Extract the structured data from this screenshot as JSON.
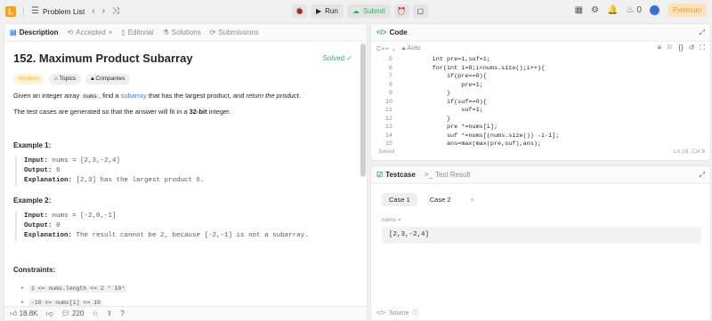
{
  "topbar": {
    "problem_list": "Problem List",
    "run": "Run",
    "submit": "Submit",
    "streak": "0",
    "premium": "Premium"
  },
  "desc_tabs": [
    "Description",
    "Accepted",
    "Editorial",
    "Solutions",
    "Submissions"
  ],
  "problem": {
    "title": "152. Maximum Product Subarray",
    "status": "Solved",
    "difficulty": "Medium",
    "topics": "Topics",
    "companies": "Companies",
    "p1_pre": "Given an integer array",
    "p1_code": "nums",
    "p1_mid": ", find a",
    "p1_link": "subarray",
    "p1_post": "that has the largest product, and",
    "p1_em": "return the product.",
    "p2_pre": "The test cases are generated so that the answer will fit in a",
    "p2_bold": "32-bit",
    "p2_post": "integer."
  },
  "examples": [
    {
      "title": "Example 1:",
      "input_label": "Input:",
      "input": "nums = [2,3,-2,4]",
      "output_label": "Output:",
      "output": "6",
      "exp_label": "Explanation:",
      "exp": "[2,3] has the largest product 6."
    },
    {
      "title": "Example 2:",
      "input_label": "Input:",
      "input": "nums = [-2,0,-1]",
      "output_label": "Output:",
      "output": "0",
      "exp_label": "Explanation:",
      "exp": "The result cannot be 2, because [-2,-1] is not a subarray."
    }
  ],
  "constraints": {
    "title": "Constraints:",
    "items": [
      "1 <= nums.length <= 2 * 10⁴",
      "-10 <= nums[i] <= 10"
    ]
  },
  "footer": {
    "likes": "18.8K",
    "comments": "220"
  },
  "code_panel": {
    "title": "Code",
    "language": "C++",
    "auto": "Auto",
    "saved": "Saved",
    "position": "Ln 18, Col 9",
    "lines": [
      {
        "n": "5",
        "t": "        int pre=1,suf=1;"
      },
      {
        "n": "6",
        "t": "        for(int i=0;i<nums.size();i++){"
      },
      {
        "n": "7",
        "t": "            if(pre==0){"
      },
      {
        "n": "8",
        "t": "                pre=1;"
      },
      {
        "n": "9",
        "t": "            }"
      },
      {
        "n": "10",
        "t": "            if(suf==0){"
      },
      {
        "n": "11",
        "t": "                suf=1;"
      },
      {
        "n": "12",
        "t": "            }"
      },
      {
        "n": "13",
        "t": "            pre *=nums[i];"
      },
      {
        "n": "14",
        "t": "            suf *=nums[(nums.size()) -i-1];"
      },
      {
        "n": "15",
        "t": "            ans=max(max(pre,suf),ans);"
      }
    ]
  },
  "test_panel": {
    "tab_testcase": "Testcase",
    "tab_result": "Test Result",
    "case1": "Case 1",
    "case2": "Case 2",
    "add": "+",
    "label": "nums =",
    "value": "[2,3,-2,4]",
    "source": "Source"
  },
  "colors": {
    "accent": "#ffa116",
    "green": "#2db55d",
    "blue": "#3b82f6",
    "premium": "#f59b0c"
  }
}
